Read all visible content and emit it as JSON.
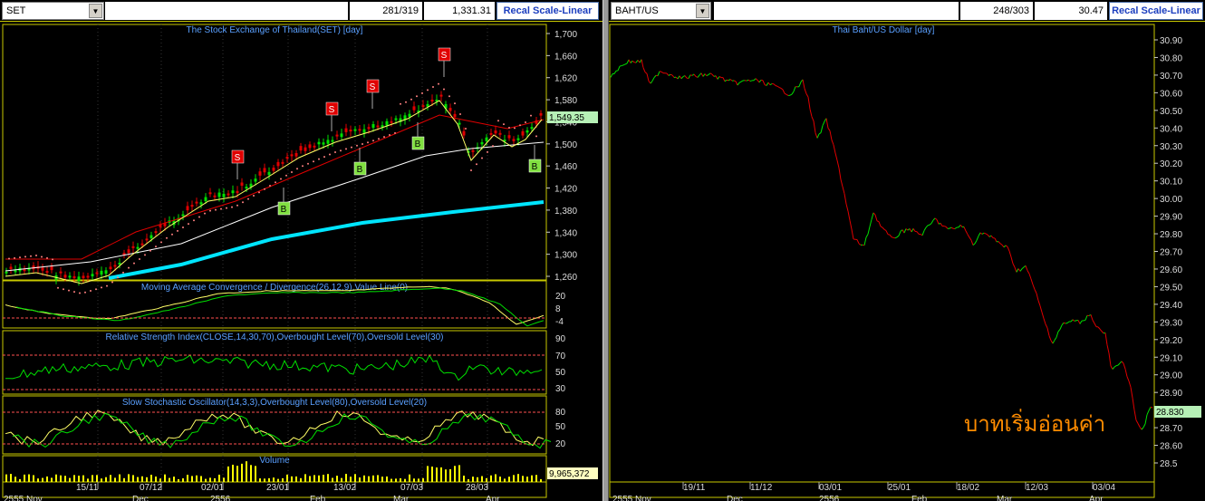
{
  "left": {
    "symbol": "SET",
    "counter": "281/319",
    "price": "1,331.31",
    "recal_label": "Recal Scale-Linear",
    "main_title": "The Stock Exchange of Thailand(SET) [day]",
    "price_ticks": [
      "1,700",
      "1,660",
      "1,620",
      "1,580",
      "1,540",
      "1,500",
      "1,460",
      "1,420",
      "1,380",
      "1,340",
      "1,300",
      "1,260"
    ],
    "last_price": "1,549.35",
    "macd_title": "Moving Average Convergence / Divergence(26,12,9),Value Line(0)",
    "macd_ticks": [
      "20",
      "8",
      "-4"
    ],
    "rsi_title": "Relative Strength Index(CLOSE,14,30,70),Overbought Level(70),Oversold Level(30)",
    "rsi_ticks": [
      "90",
      "70",
      "50",
      "30"
    ],
    "stoch_title": "Slow Stochastic Oscillator(14,3,3),Overbought Level(80),Oversold Level(20)",
    "stoch_ticks": [
      "80",
      "50",
      "20"
    ],
    "volume_title": "Volume",
    "volume_last": "9,965,372",
    "x_dates": [
      "15/11",
      "07/12",
      "02/01",
      "23/01",
      "13/02",
      "07/03",
      "28/03"
    ],
    "x_months": [
      "2555 Nov",
      "Dec",
      "2556",
      "Feb",
      "Mar",
      "Apr"
    ],
    "signals": [
      {
        "type": "S",
        "label": "S"
      },
      {
        "type": "B",
        "label": "B"
      },
      {
        "type": "S",
        "label": "S"
      },
      {
        "type": "B",
        "label": "B"
      },
      {
        "type": "S",
        "label": "S"
      },
      {
        "type": "B",
        "label": "B"
      },
      {
        "type": "S",
        "label": "S"
      },
      {
        "type": "B",
        "label": "B"
      }
    ]
  },
  "right": {
    "symbol": "BAHT/US",
    "counter": "248/303",
    "price": "30.47",
    "recal_label": "Recal Scale-Linear",
    "main_title": "Thai Baht/US Dollar [day]",
    "price_ticks": [
      "30.90",
      "30.80",
      "30.70",
      "30.60",
      "30.50",
      "30.40",
      "30.30",
      "30.20",
      "30.10",
      "30.00",
      "29.90",
      "29.80",
      "29.70",
      "29.60",
      "29.50",
      "29.40",
      "29.30",
      "29.20",
      "29.10",
      "29.00",
      "28.90",
      "28.80",
      "28.70",
      "28.60",
      "28.5"
    ],
    "last_price": "28.830",
    "annotation": "บาทเริ่มอ่อนค่า",
    "x_dates": [
      "19/11",
      "11/12",
      "03/01",
      "25/01",
      "18/02",
      "12/03",
      "03/04"
    ],
    "x_months": [
      "2555 Nov",
      "Dec",
      "2556",
      "Feb",
      "Mar",
      "Apr"
    ]
  },
  "colors": {
    "up": "#00e000",
    "down": "#e00000",
    "ma_slow": "#ffffff",
    "ma_long": "#00e5ff",
    "ma_fast": "#ffff66",
    "sell": "#e00000",
    "buy": "#80e040",
    "frame": "#c8c800",
    "annotation": "#ff8c00"
  },
  "chart_data": [
    {
      "type": "line",
      "title": "The Stock Exchange of Thailand(SET) [day]",
      "x": [
        "15/11",
        "07/12",
        "02/01",
        "23/01",
        "13/02",
        "07/03",
        "28/03"
      ],
      "series": [
        {
          "name": "SET",
          "values": [
            1285,
            1360,
            1440,
            1505,
            1560,
            1580,
            1549.35
          ]
        }
      ],
      "ylim": [
        1240,
        1720
      ]
    },
    {
      "type": "line",
      "title": "Thai Baht/US Dollar [day]",
      "x": [
        "19/11",
        "11/12",
        "03/01",
        "25/01",
        "18/02",
        "12/03",
        "03/04"
      ],
      "series": [
        {
          "name": "BAHT/US",
          "values": [
            30.72,
            30.68,
            30.45,
            29.78,
            29.85,
            29.55,
            28.83
          ]
        }
      ],
      "ylim": [
        28.5,
        30.95
      ]
    }
  ]
}
